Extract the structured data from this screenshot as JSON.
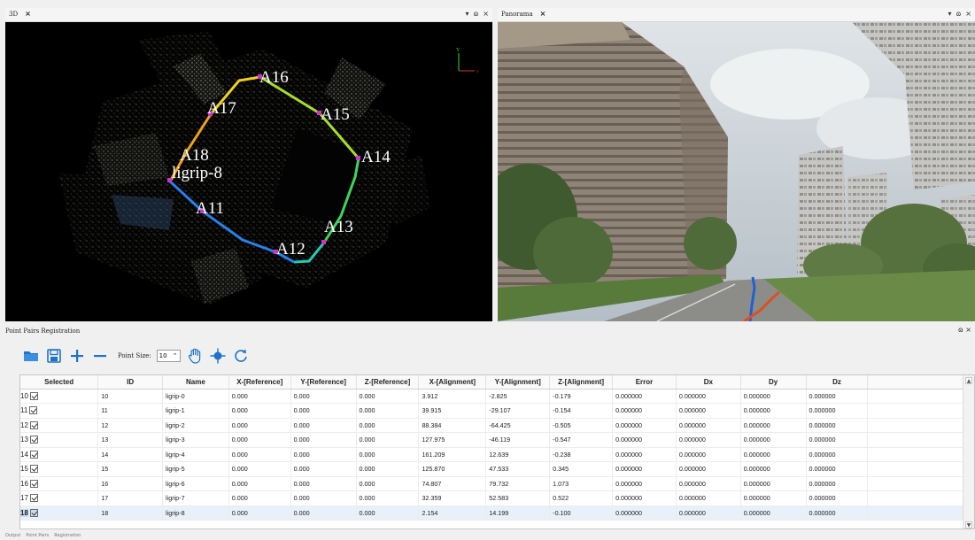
{
  "tabs": {
    "view3d": {
      "title": "3D",
      "close": "×"
    },
    "panorama": {
      "title": "Panorama",
      "close": "×"
    },
    "ctrl_menu": "▾",
    "ctrl_float": "ɷ",
    "ctrl_close": "×"
  },
  "view3d": {
    "labels": [
      "A16",
      "A17",
      "A15",
      "A18",
      "A14",
      "ligrip-8",
      "A11",
      "A13",
      "A12"
    ],
    "axis": {
      "y": "Y",
      "x": "x"
    }
  },
  "panel": {
    "title": "Point Pairs Registration",
    "float_btn": "ɷ ×"
  },
  "toolbar": {
    "point_size_label": "Point Size:",
    "point_size_value": "10",
    "spin_arrows": "⌃"
  },
  "table": {
    "headers": [
      "Selected",
      "ID",
      "Name",
      "X-[Reference]",
      "Y-[Reference]",
      "Z-[Reference]",
      "X-[Alignment]",
      "Y-[Alignment]",
      "Z-[Alignment]",
      "Error",
      "Dx",
      "Dy",
      "Dz"
    ],
    "rows": [
      {
        "n": "10",
        "id": "10",
        "name": "ligrip-0",
        "xr": "0.000",
        "yr": "0.000",
        "zr": "0.000",
        "xa": "3.912",
        "ya": "-2.825",
        "za": "-0.179",
        "err": "0.000000",
        "dx": "0.000000",
        "dy": "0.000000",
        "dz": "0.000000"
      },
      {
        "n": "11",
        "id": "11",
        "name": "ligrip-1",
        "xr": "0.000",
        "yr": "0.000",
        "zr": "0.000",
        "xa": "39.915",
        "ya": "-29.107",
        "za": "-0.154",
        "err": "0.000000",
        "dx": "0.000000",
        "dy": "0.000000",
        "dz": "0.000000"
      },
      {
        "n": "12",
        "id": "12",
        "name": "ligrip-2",
        "xr": "0.000",
        "yr": "0.000",
        "zr": "0.000",
        "xa": "88.384",
        "ya": "-64.425",
        "za": "-0.505",
        "err": "0.000000",
        "dx": "0.000000",
        "dy": "0.000000",
        "dz": "0.000000"
      },
      {
        "n": "13",
        "id": "13",
        "name": "ligrip-3",
        "xr": "0.000",
        "yr": "0.000",
        "zr": "0.000",
        "xa": "127.975",
        "ya": "-46.119",
        "za": "-0.547",
        "err": "0.000000",
        "dx": "0.000000",
        "dy": "0.000000",
        "dz": "0.000000"
      },
      {
        "n": "14",
        "id": "14",
        "name": "ligrip-4",
        "xr": "0.000",
        "yr": "0.000",
        "zr": "0.000",
        "xa": "161.209",
        "ya": "12.639",
        "za": "-0.238",
        "err": "0.000000",
        "dx": "0.000000",
        "dy": "0.000000",
        "dz": "0.000000"
      },
      {
        "n": "15",
        "id": "15",
        "name": "ligrip-5",
        "xr": "0.000",
        "yr": "0.000",
        "zr": "0.000",
        "xa": "125.870",
        "ya": "47.533",
        "za": "0.345",
        "err": "0.000000",
        "dx": "0.000000",
        "dy": "0.000000",
        "dz": "0.000000"
      },
      {
        "n": "16",
        "id": "16",
        "name": "ligrip-6",
        "xr": "0.000",
        "yr": "0.000",
        "zr": "0.000",
        "xa": "74.807",
        "ya": "79.732",
        "za": "1.073",
        "err": "0.000000",
        "dx": "0.000000",
        "dy": "0.000000",
        "dz": "0.000000"
      },
      {
        "n": "17",
        "id": "17",
        "name": "ligrip-7",
        "xr": "0.000",
        "yr": "0.000",
        "zr": "0.000",
        "xa": "32.359",
        "ya": "52.583",
        "za": "0.522",
        "err": "0.000000",
        "dx": "0.000000",
        "dy": "0.000000",
        "dz": "0.000000"
      },
      {
        "n": "18",
        "id": "18",
        "name": "ligrip-8",
        "xr": "0.000",
        "yr": "0.000",
        "zr": "0.000",
        "xa": "2.154",
        "ya": "14.199",
        "za": "-0.100",
        "err": "0.000000",
        "dx": "0.000000",
        "dy": "0.000000",
        "dz": "0.000000"
      }
    ],
    "selected_row": "18"
  },
  "bottom_tabs": [
    "Output",
    "Point Pairs",
    "Registration"
  ],
  "colors": {
    "accent": "#1e73c8",
    "route_yellow": "#f0d21c",
    "route_green": "#3bd65a",
    "route_blue": "#2a7fe8",
    "marker": "#cc33cc"
  }
}
